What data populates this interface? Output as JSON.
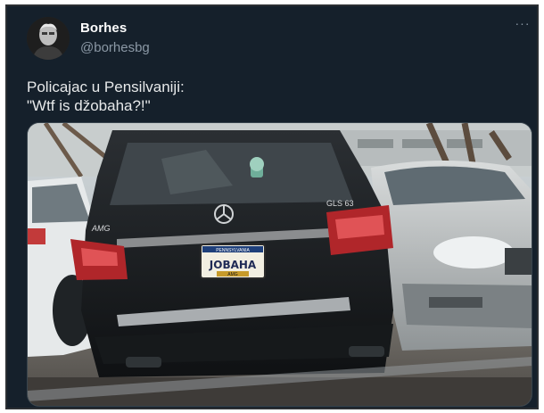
{
  "tweet": {
    "author_name": "Borhes",
    "author_handle": "@borhesbg",
    "more_icon": "more-dots-icon",
    "more_label": "···",
    "text_lines": [
      "Policajac u Pensilvaniji:",
      "\"Wtf is džobaha?!\""
    ]
  },
  "photo": {
    "emblem_text": "AMG",
    "badge_text": "GLS 63",
    "plate_top": "PENNSYLVANIA",
    "plate_main": "JOBAHA",
    "plate_bottom": "AMG"
  }
}
